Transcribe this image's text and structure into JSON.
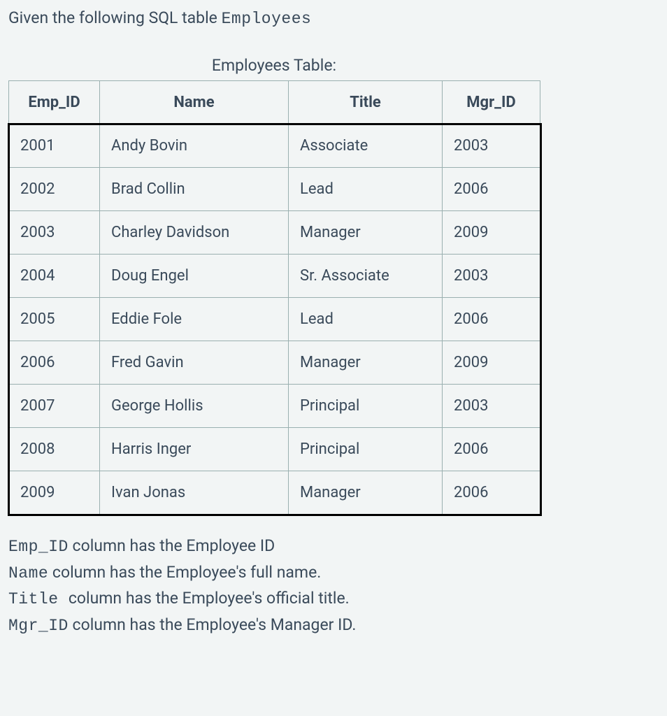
{
  "intro": {
    "prefix": "Given the following SQL table ",
    "table_name": "Employees"
  },
  "caption": "Employees Table:",
  "headers": {
    "emp_id": "Emp_ID",
    "name": "Name",
    "title": "Title",
    "mgr_id": "Mgr_ID"
  },
  "rows": [
    {
      "emp_id": "2001",
      "name": "Andy Bovin",
      "title": "Associate",
      "mgr_id": "2003"
    },
    {
      "emp_id": "2002",
      "name": "Brad Collin",
      "title": "Lead",
      "mgr_id": "2006"
    },
    {
      "emp_id": "2003",
      "name": "Charley Davidson",
      "title": "Manager",
      "mgr_id": "2009"
    },
    {
      "emp_id": "2004",
      "name": "Doug Engel",
      "title": "Sr. Associate",
      "mgr_id": "2003"
    },
    {
      "emp_id": "2005",
      "name": "Eddie Fole",
      "title": "Lead",
      "mgr_id": "2006"
    },
    {
      "emp_id": "2006",
      "name": "Fred Gavin",
      "title": "Manager",
      "mgr_id": "2009"
    },
    {
      "emp_id": "2007",
      "name": "George Hollis",
      "title": "Principal",
      "mgr_id": "2003"
    },
    {
      "emp_id": "2008",
      "name": "Harris Inger",
      "title": "Principal",
      "mgr_id": "2006"
    },
    {
      "emp_id": "2009",
      "name": "Ivan Jonas",
      "title": "Manager",
      "mgr_id": "2006"
    }
  ],
  "desc": {
    "emp_id_col": {
      "mono": "Emp_ID",
      "text": " column has the Employee ID"
    },
    "name_col": {
      "mono": "Name",
      "text": " column has the Employee's full name."
    },
    "title_col": {
      "mono": "Title ",
      "text": " column has the Employee's official title."
    },
    "mgr_id_col": {
      "mono": "Mgr_ID",
      "text": " column has the Employee's Manager ID."
    }
  },
  "chart_data": {
    "type": "table",
    "title": "Employees Table:",
    "columns": [
      "Emp_ID",
      "Name",
      "Title",
      "Mgr_ID"
    ],
    "rows": [
      [
        "2001",
        "Andy Bovin",
        "Associate",
        "2003"
      ],
      [
        "2002",
        "Brad Collin",
        "Lead",
        "2006"
      ],
      [
        "2003",
        "Charley Davidson",
        "Manager",
        "2009"
      ],
      [
        "2004",
        "Doug Engel",
        "Sr. Associate",
        "2003"
      ],
      [
        "2005",
        "Eddie Fole",
        "Lead",
        "2006"
      ],
      [
        "2006",
        "Fred Gavin",
        "Manager",
        "2009"
      ],
      [
        "2007",
        "George Hollis",
        "Principal",
        "2003"
      ],
      [
        "2008",
        "Harris Inger",
        "Principal",
        "2006"
      ],
      [
        "2009",
        "Ivan Jonas",
        "Manager",
        "2006"
      ]
    ]
  }
}
